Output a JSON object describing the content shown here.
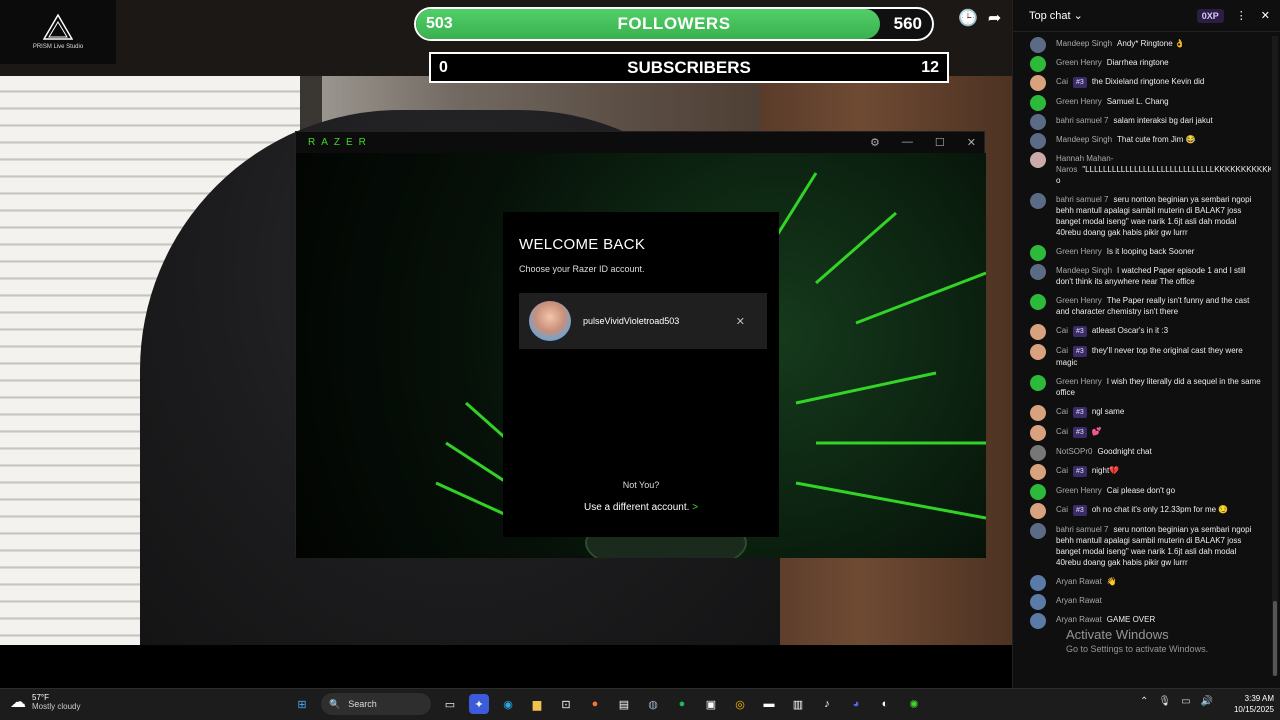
{
  "overlay": {
    "logo_text": "PRISM Live Studio",
    "followers": {
      "label": "FOLLOWERS",
      "current": "503",
      "goal": "560",
      "progress": 0.9
    },
    "subscribers": {
      "label": "SUBSCRIBERS",
      "current": "0",
      "goal": "12"
    }
  },
  "razer": {
    "brand": "RAZER",
    "welcome": "WELCOME BACK",
    "subtitle": "Choose your Razer ID account.",
    "account_name": "pulseVividVioletroad503",
    "not_you": "Not You?",
    "use_different": "Use a different account.",
    "use_different_arrow": ">"
  },
  "chat": {
    "mode": "Top chat",
    "xp_badge": "0XP",
    "messages": [
      {
        "name": "Mandeep Singh",
        "text": "Andy* Ringtone 👌",
        "avatar": "b"
      },
      {
        "name": "Green Henry",
        "text": "Diarrhea ringtone",
        "avatar": "g"
      },
      {
        "name": "Cai",
        "badge": "#3",
        "text": "the Dixieland ringtone Kevin did",
        "avatar": "c"
      },
      {
        "name": "Green Henry",
        "text": "Samuel L. Chang",
        "avatar": "g"
      },
      {
        "name": "bahri samuel 7",
        "text": "salam interaksi bg dari jakut",
        "avatar": "b"
      },
      {
        "name": "Mandeep Singh",
        "text": "That cute from Jim 😂",
        "avatar": "b"
      },
      {
        "name": "Hannah Mahan-Naros",
        "text": "\"LLLLLLLLLLLLLLLLLLLLLLLLLLLLLKKKKKKKKKKKKKKK?o",
        "avatar": "h"
      },
      {
        "name": "bahri samuel 7",
        "text": "seru nonton beginian ya sembari ngopi behh mantull apalagi sambil muterin di BALAK7 joss banget modal iseng\" wae narik 1.6jt asli dah modal 40rebu doang gak habis pikir gw lurrr",
        "avatar": "b"
      },
      {
        "name": "Green Henry",
        "text": "Is it looping back Sooner",
        "avatar": "g"
      },
      {
        "name": "Mandeep Singh",
        "text": "I watched Paper episode 1 and I still don't think its anywhere near The office",
        "avatar": "b"
      },
      {
        "name": "Green Henry",
        "text": "The Paper really isn't funny and the cast and character chemistry isn't there",
        "avatar": "g"
      },
      {
        "name": "Cai",
        "badge": "#3",
        "text": "atleast Oscar's in it :3",
        "avatar": "c"
      },
      {
        "name": "Cai",
        "badge": "#3",
        "text": "they'll never top the original cast they were magic",
        "avatar": "c"
      },
      {
        "name": "Green Henry",
        "text": "I wish they literally did a sequel in the same office",
        "avatar": "g"
      },
      {
        "name": "Cai",
        "badge": "#3",
        "text": "ngl same",
        "avatar": "c"
      },
      {
        "name": "Cai",
        "badge": "#3",
        "text": "💕",
        "avatar": "c"
      },
      {
        "name": "NotSOPr0",
        "text": "Goodnight chat",
        "avatar": "n"
      },
      {
        "name": "Cai",
        "badge": "#3",
        "text": "night💔",
        "avatar": "c"
      },
      {
        "name": "Green Henry",
        "text": "Cai please don't go",
        "avatar": "g"
      },
      {
        "name": "Cai",
        "badge": "#3",
        "text": "oh no chat it's only 12.33pm for me 😏",
        "avatar": "c"
      },
      {
        "name": "bahri samuel 7",
        "text": "seru nonton beginian ya sembari ngopi behh mantull apalagi sambil muterin di BALAK7 joss banget modal iseng\" wae narik 1.6jt asli dah modal 40rebu doang gak habis pikir gw lurrr",
        "avatar": "b"
      },
      {
        "name": "Aryan Rawat",
        "text": "👋",
        "avatar": "r"
      },
      {
        "name": "Aryan Rawat",
        "text": "",
        "avatar": "r"
      },
      {
        "name": "Aryan Rawat",
        "text": "GAME OVER",
        "avatar": "r"
      }
    ],
    "watermark_title": "Activate Windows",
    "watermark_sub": "Go to Settings to activate Windows."
  },
  "taskbar": {
    "weather_temp": "57°F",
    "weather_desc": "Mostly cloudy",
    "search_label": "Search",
    "time": "3:39 AM",
    "date": "10/15/2025"
  },
  "colors": {
    "accent_green": "#44d62c",
    "follower_green": "#4cc760",
    "chat_bg": "#0f0f10"
  }
}
